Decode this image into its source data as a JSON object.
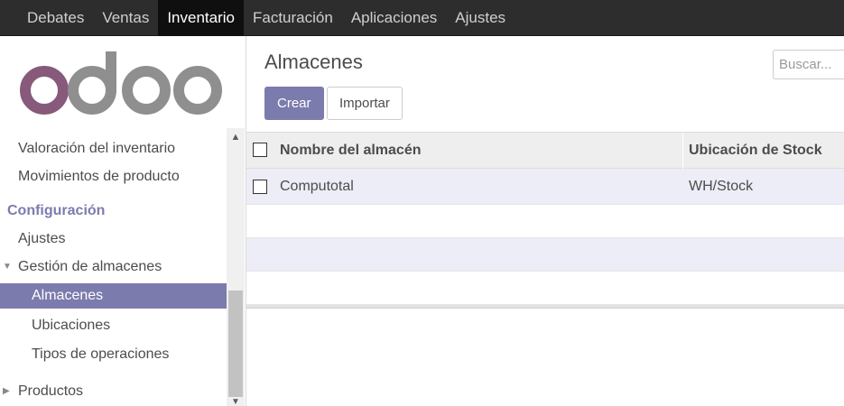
{
  "topbar": {
    "items": [
      {
        "label": "Debates"
      },
      {
        "label": "Ventas"
      },
      {
        "label": "Inventario",
        "active": true
      },
      {
        "label": "Facturación"
      },
      {
        "label": "Aplicaciones"
      },
      {
        "label": "Ajustes"
      }
    ]
  },
  "brand": {
    "logo_text": "odoo",
    "logo_color": "#8f8f8f",
    "logo_accent": "#875a7b"
  },
  "sidebar": {
    "items": [
      {
        "label": "Valoración del inventario"
      },
      {
        "label": "Movimientos de producto"
      },
      {
        "label": "Configuración"
      },
      {
        "label": "Ajustes"
      },
      {
        "label": "Gestión de almacenes"
      },
      {
        "label": "Almacenes"
      },
      {
        "label": "Ubicaciones"
      },
      {
        "label": "Tipos de operaciones"
      },
      {
        "label": "Productos"
      }
    ]
  },
  "main": {
    "title": "Almacenes",
    "search_placeholder": "Buscar...",
    "create_label": "Crear",
    "import_label": "Importar",
    "columns": [
      "Nombre del almacén",
      "Ubicación de Stock"
    ],
    "rows": [
      {
        "name": "Computotal",
        "location": "WH/Stock"
      }
    ]
  },
  "colors": {
    "accent": "#7c7bad",
    "navbar": "#2d2d2d"
  }
}
